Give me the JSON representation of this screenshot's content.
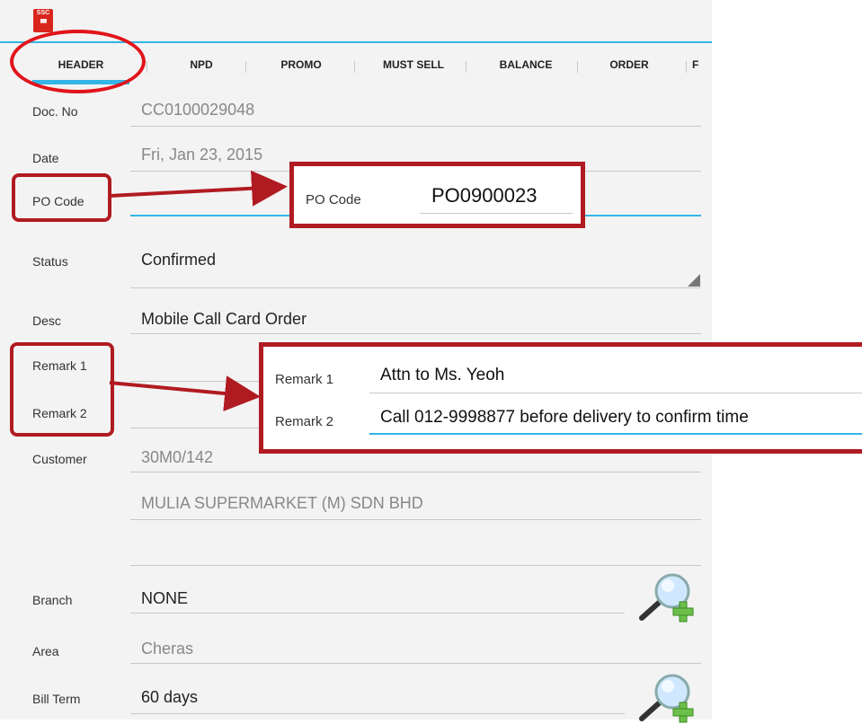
{
  "app": {
    "logo_text": "SSC",
    "logo_sub": "▮▮▮"
  },
  "tabs": [
    {
      "label": "HEADER"
    },
    {
      "label": "NPD"
    },
    {
      "label": "PROMO"
    },
    {
      "label": "MUST SELL"
    },
    {
      "label": "BALANCE"
    },
    {
      "label": "ORDER"
    },
    {
      "label": "F"
    }
  ],
  "form": {
    "doc_no": {
      "label": "Doc. No",
      "value": "CC0100029048"
    },
    "date": {
      "label": "Date",
      "value": "Fri, Jan 23, 2015"
    },
    "po_code": {
      "label": "PO Code",
      "value": ""
    },
    "status": {
      "label": "Status",
      "value": "Confirmed"
    },
    "desc": {
      "label": "Desc",
      "value": "Mobile Call Card Order"
    },
    "remark1": {
      "label": "Remark 1",
      "value": ""
    },
    "remark2": {
      "label": "Remark 2",
      "value": ""
    },
    "customer": {
      "label": "Customer",
      "code": "30M0/142",
      "name": "MULIA SUPERMARKET (M) SDN BHD"
    },
    "branch": {
      "label": "Branch",
      "value": "NONE"
    },
    "area": {
      "label": "Area",
      "value": "Cheras"
    },
    "bill_term": {
      "label": "Bill Term",
      "value": "60 days"
    }
  },
  "callouts": {
    "po": {
      "label": "PO Code",
      "value": "PO0900023"
    },
    "remarks": {
      "r1_label": "Remark 1",
      "r1_value": "Attn to Ms. Yeoh",
      "r2_label": "Remark 2",
      "r2_value": "Call 012-9998877 before delivery to confirm time"
    }
  },
  "colors": {
    "accent": "#33b5e5",
    "annotation": "#b01b21",
    "annotation_circle": "#e1141b"
  },
  "icons": [
    "logo-icon",
    "search-add-icon",
    "dropdown-corner-icon"
  ]
}
